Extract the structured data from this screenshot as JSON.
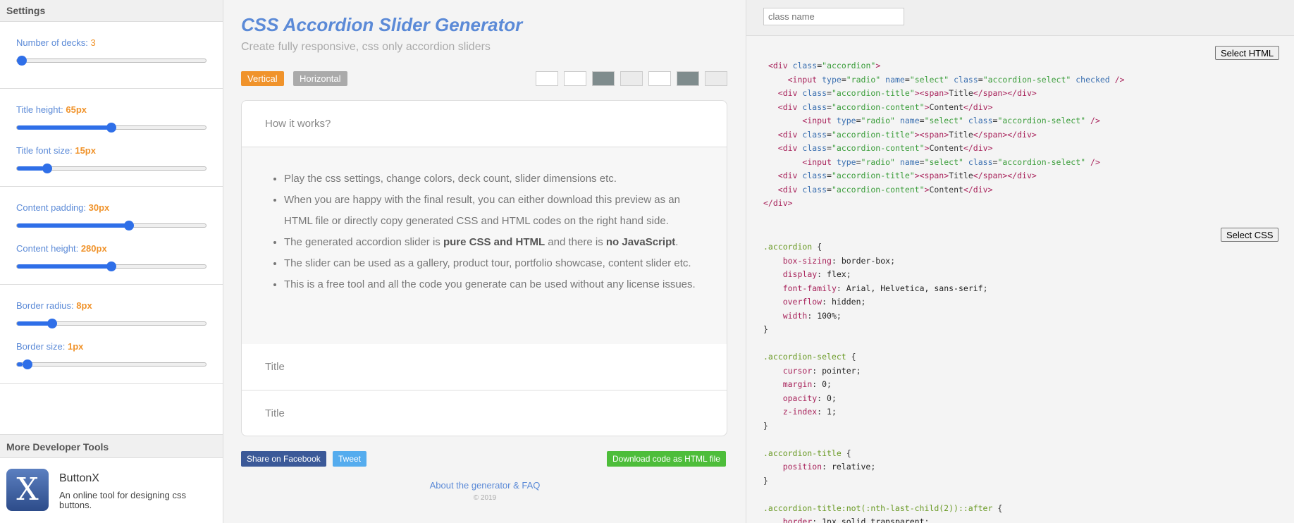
{
  "sidebar": {
    "header": "Settings",
    "settings": [
      {
        "label": "Number of decks:",
        "value": "3",
        "fraction": 0.0
      },
      {
        "label": "Title height:",
        "value": "65px",
        "fraction": 0.5
      },
      {
        "label": "Title font size:",
        "value": "15px",
        "fraction": 0.14
      },
      {
        "label": "Content padding:",
        "value": "30px",
        "fraction": 0.6
      },
      {
        "label": "Content height:",
        "value": "280px",
        "fraction": 0.5
      },
      {
        "label": "Border radius:",
        "value": "8px",
        "fraction": 0.17
      },
      {
        "label": "Border size:",
        "value": "1px",
        "fraction": 0.03
      }
    ],
    "more_header": "More Developer Tools",
    "tool": {
      "logo": "X",
      "name": "ButtonX",
      "description": "An online tool for designing css buttons."
    }
  },
  "main": {
    "title": "CSS Accordion Slider Generator",
    "subtitle": "Create fully responsive, css only accordion sliders",
    "orientation": {
      "vertical": "Vertical",
      "horizontal": "Horizontal",
      "selected": "Vertical"
    },
    "swatches": [
      "#ffffff",
      "#ffffff",
      "#7f8c8d",
      "#ebebeb",
      "#ffffff",
      "#7f8c8d",
      "#ebebeb"
    ],
    "accordion": {
      "panel1_title": "How it works?",
      "bullets": [
        "Play the css settings, change colors, deck count, slider dimensions etc.",
        "When you are happy with the final result, you can either download this preview as an HTML file or directly copy generated CSS and HTML codes on the right hand side.",
        "The generated accordion slider is ",
        "pure CSS and HTML",
        " and there is ",
        "no JavaScript",
        ".",
        "The slider can be used as a gallery, product tour, portfolio showcase, content slider etc.",
        "This is a free tool and all the code you generate can be used without any license issues."
      ],
      "panel2_title": "Title",
      "panel3_title": "Title"
    },
    "share_facebook": "Share on Facebook",
    "tweet": "Tweet",
    "download": "Download code as HTML file",
    "about": "About the generator & FAQ",
    "copyright": "© 2019"
  },
  "code": {
    "class_placeholder": "class name",
    "select_html": "Select HTML",
    "select_css": "Select CSS"
  },
  "colors": {
    "accent": "#5b8ad7",
    "orange": "#f0932b",
    "slider": "#2f6fe8",
    "download": "#4dbd3a",
    "facebook": "#3b5998",
    "twitter": "#55acee"
  }
}
